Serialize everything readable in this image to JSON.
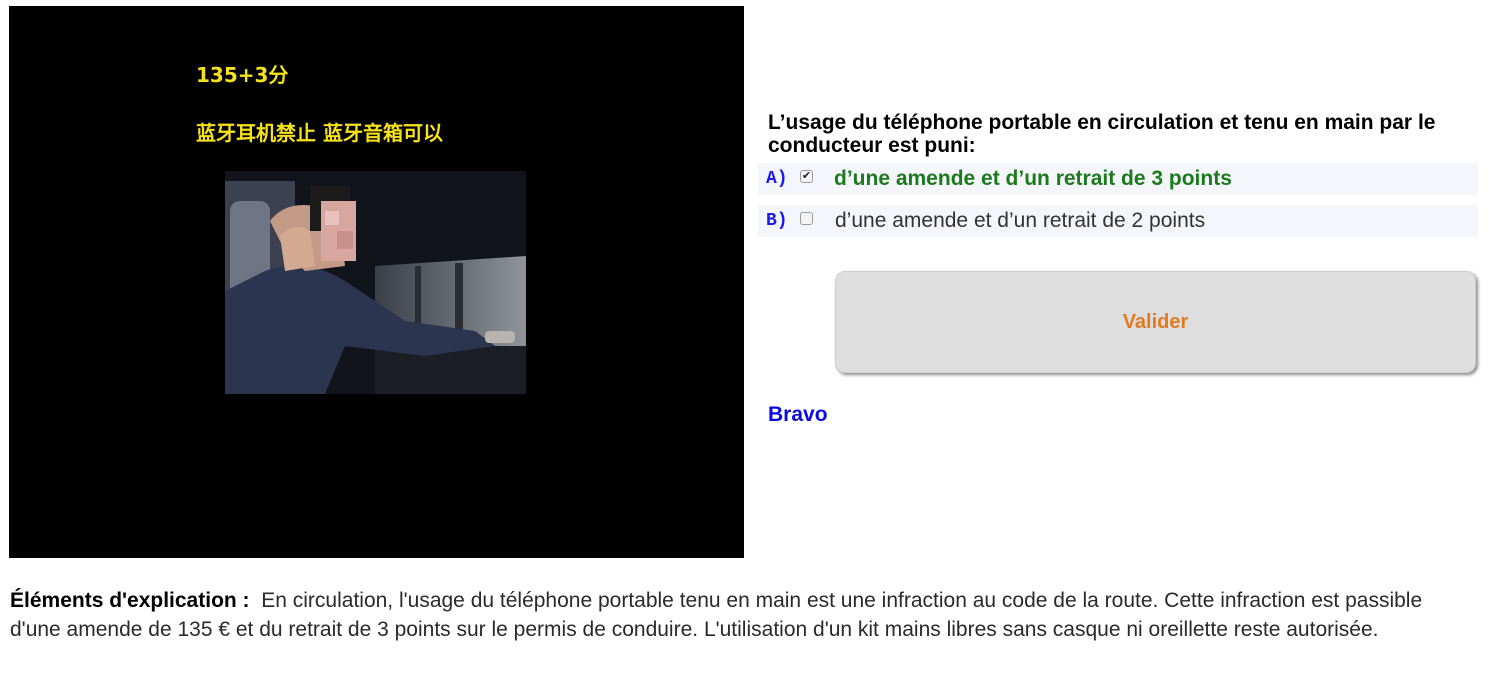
{
  "media": {
    "caption_line1": "135+3分",
    "caption_line2": "蓝牙耳机禁止 蓝牙音箱可以",
    "caption_color": "#f5e21a",
    "photo_alt": "driver holding a mobile phone to his ear"
  },
  "quiz": {
    "question": "L’usage du téléphone portable en circulation et tenu en main par le conducteur est puni:",
    "options": [
      {
        "letter": "A)",
        "text": "d’une amende et d’un retrait de 3 points",
        "checked": true,
        "status": "correct"
      },
      {
        "letter": "B)",
        "text": "d’une amende et d’un retrait de 2 points",
        "checked": false,
        "status": "neutral"
      }
    ],
    "submit_label": "Valider",
    "feedback": "Bravo"
  },
  "explanation": {
    "label": "Éléments d'explication :",
    "text": "En circulation, l'usage du téléphone portable tenu en main est une infraction au code de la route. Cette infraction est passible d'une amende de 135 € et du retrait de 3 points sur le permis de conduire. L'utilisation d'un kit mains libres sans casque ni oreillette reste autorisée."
  },
  "colors": {
    "letter": "#1a1aee",
    "correct": "#1c7a1c",
    "neutral": "#333333",
    "button_text": "#e07b22",
    "feedback": "#0b0be0"
  }
}
